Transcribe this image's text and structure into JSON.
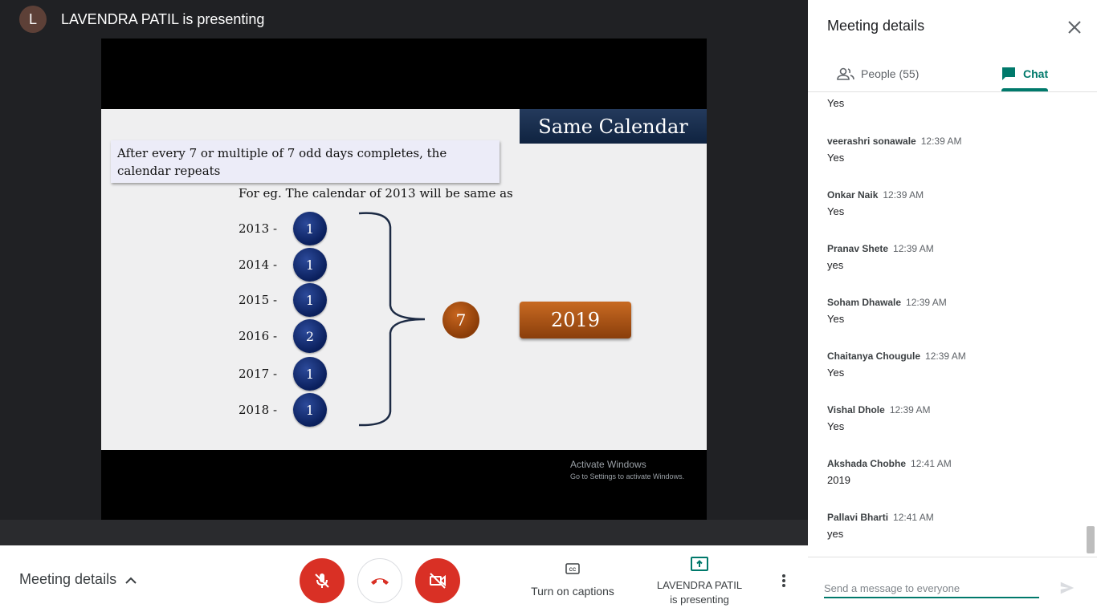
{
  "presenter": {
    "avatar_letter": "L",
    "title": "LAVENDRA PATIL is presenting"
  },
  "slide": {
    "title": "Same Calendar",
    "note": "After every 7 or multiple of 7 odd days completes, the calendar repeats",
    "example": "For eg. The calendar of 2013 will be same as",
    "years": [
      {
        "year": "2013 -",
        "odd_days": "1"
      },
      {
        "year": "2014 -",
        "odd_days": "1"
      },
      {
        "year": "2015 -",
        "odd_days": "1"
      },
      {
        "year": "2016 -",
        "odd_days": "2"
      },
      {
        "year": "2017 -",
        "odd_days": "1"
      },
      {
        "year": "2018 -",
        "odd_days": "1"
      }
    ],
    "total": "7",
    "result": "2019"
  },
  "watermark": {
    "line1": "Activate Windows",
    "line2": "Go to Settings to activate Windows."
  },
  "controls": {
    "meeting_details": "Meeting details",
    "captions": "Turn on captions",
    "presenting_line1": "LAVENDRA PATIL",
    "presenting_line2": "is presenting"
  },
  "panel": {
    "title": "Meeting details",
    "tabs": {
      "people": "People (55)",
      "chat": "Chat"
    },
    "messages": [
      {
        "sender": "",
        "time": "",
        "text": "Yes"
      },
      {
        "sender": "veerashri sonawale",
        "time": "12:39 AM",
        "text": "Yes"
      },
      {
        "sender": "Onkar Naik",
        "time": "12:39 AM",
        "text": "Yes"
      },
      {
        "sender": "Pranav Shete",
        "time": "12:39 AM",
        "text": "yes"
      },
      {
        "sender": "Soham Dhawale",
        "time": "12:39 AM",
        "text": "Yes"
      },
      {
        "sender": "Chaitanya Chougule",
        "time": "12:39 AM",
        "text": "Yes"
      },
      {
        "sender": "Vishal Dhole",
        "time": "12:39 AM",
        "text": "Yes"
      },
      {
        "sender": "Akshada Chobhe",
        "time": "12:41 AM",
        "text": "2019"
      },
      {
        "sender": "Pallavi Bharti",
        "time": "12:41 AM",
        "text": "yes"
      }
    ],
    "compose_placeholder": "Send a message to everyone"
  },
  "colors": {
    "accent": "#00796b",
    "danger": "#d93025",
    "slide_navy": "#0a1f5c",
    "slide_orange": "#b3561a"
  }
}
